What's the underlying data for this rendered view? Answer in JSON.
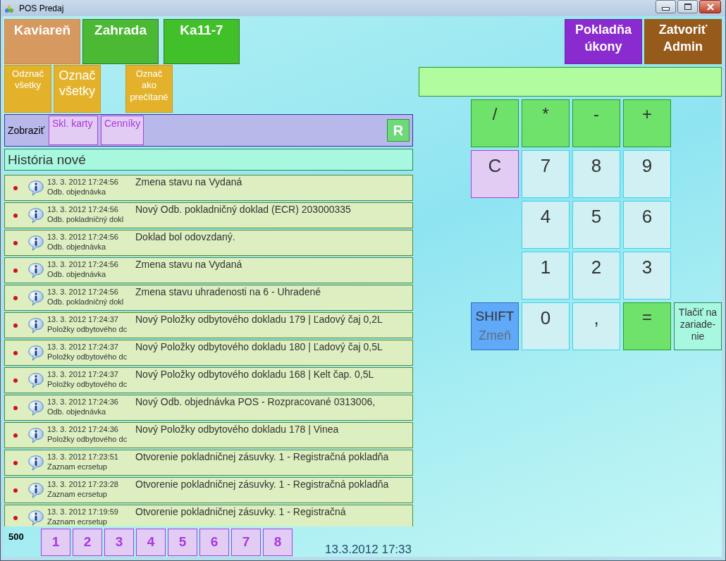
{
  "window": {
    "title": "POS Predaj"
  },
  "location_buttons": [
    {
      "label": "Kaviareň",
      "color": "#d6995f"
    },
    {
      "label": "Zahrada",
      "color": "#4cb934"
    },
    {
      "label": "Ka11-7",
      "color": "#42c02a"
    }
  ],
  "action_buttons": [
    {
      "label": "Pokladňa úkony",
      "color": "#8a2bcf"
    },
    {
      "label": "Zatvoriť Admin",
      "color": "#965a1a"
    }
  ],
  "mark_buttons": [
    {
      "label": "Odznač všetky",
      "kind": "small"
    },
    {
      "label": "Označ všetky",
      "kind": "large"
    },
    {
      "label": "Označ ako prečítané",
      "kind": "small"
    }
  ],
  "filter_bar": {
    "label": "Zobraziť",
    "tabs": [
      "Skl. karty",
      "Cenníky"
    ],
    "refresh": "R"
  },
  "history": {
    "title": "História nové",
    "entries": [
      {
        "time": "13. 3. 2012 17:24:56",
        "source": "Odb. objednávka",
        "message": "Zmena stavu na Vydaná"
      },
      {
        "time": "13. 3. 2012 17:24:56",
        "source": "Odb. pokladničný dokl",
        "message": "Nový Odb. pokladničný doklad (ECR) 203000335"
      },
      {
        "time": "13. 3. 2012 17:24:56",
        "source": "Odb. objednávka",
        "message": "Doklad bol odovzdaný."
      },
      {
        "time": "13. 3. 2012 17:24:56",
        "source": "Odb. objednávka",
        "message": "Zmena stavu na Vydaná"
      },
      {
        "time": "13. 3. 2012 17:24:56",
        "source": "Odb. pokladničný dokl",
        "message": "Zmena stavu uhradenosti na 6 - Uhradené"
      },
      {
        "time": "13. 3. 2012 17:24:37",
        "source": "Položky odbytového dc",
        "message": "Nový Položky odbytového dokladu 179 | Ľadový čaj 0,2L"
      },
      {
        "time": "13. 3. 2012 17:24:37",
        "source": "Položky odbytového dc",
        "message": "Nový Položky odbytového dokladu 180 | Ľadový čaj 0,5L"
      },
      {
        "time": "13. 3. 2012 17:24:37",
        "source": "Položky odbytového dc",
        "message": "Nový Položky odbytového dokladu 168 | Kelt čap. 0,5L"
      },
      {
        "time": "13. 3. 2012 17:24:36",
        "source": "Odb. objednávka",
        "message": "Nový Odb. objednávka POS - Rozpracované 0313006,"
      },
      {
        "time": "13. 3. 2012 17:24:36",
        "source": "Položky odbytového dc",
        "message": "Nový Položky odbytového dokladu 178 | Vinea"
      },
      {
        "time": "13. 3. 2012 17:23:51",
        "source": "Zaznam ecrsetup",
        "message": "Otvorenie pokladničnej zásuvky. 1 - Registračná pokladňa"
      },
      {
        "time": "13. 3. 2012 17:23:28",
        "source": "Zaznam ecrsetup",
        "message": "Otvorenie pokladničnej zásuvky. 1 - Registračná pokladňa"
      },
      {
        "time": "13. 3. 2012 17:19:59",
        "source": "Zaznam ecrsetup",
        "message": "Otvorenie pokladničnej zásuvky. 1 - Registračná"
      }
    ]
  },
  "footer": {
    "count": "500",
    "pages": [
      "1",
      "2",
      "3",
      "4",
      "5",
      "6",
      "7",
      "8"
    ],
    "datetime": "13.3.2012 17:33"
  },
  "keypad": {
    "rows": [
      [
        {
          "label": "/",
          "kind": "op"
        },
        {
          "label": "*",
          "kind": "op"
        },
        {
          "label": "-",
          "kind": "op"
        },
        {
          "label": "+",
          "kind": "op"
        }
      ],
      [
        {
          "label": "C",
          "kind": "clear"
        },
        {
          "label": "7",
          "kind": "digit"
        },
        {
          "label": "8",
          "kind": "digit"
        },
        {
          "label": "9",
          "kind": "digit"
        }
      ],
      [
        {
          "label": "4",
          "kind": "digit"
        },
        {
          "label": "5",
          "kind": "digit"
        },
        {
          "label": "6",
          "kind": "digit"
        }
      ],
      [
        {
          "label": "1",
          "kind": "digit"
        },
        {
          "label": "2",
          "kind": "digit"
        },
        {
          "label": "3",
          "kind": "digit"
        }
      ],
      [
        {
          "label": "SHIFT",
          "sublabel": "Zmeň",
          "kind": "shift"
        },
        {
          "label": "0",
          "kind": "digit"
        },
        {
          "label": ",",
          "kind": "digit"
        },
        {
          "label": "=",
          "kind": "op"
        },
        {
          "label": "Tlačiť na zariade-nie",
          "kind": "print"
        }
      ]
    ]
  }
}
